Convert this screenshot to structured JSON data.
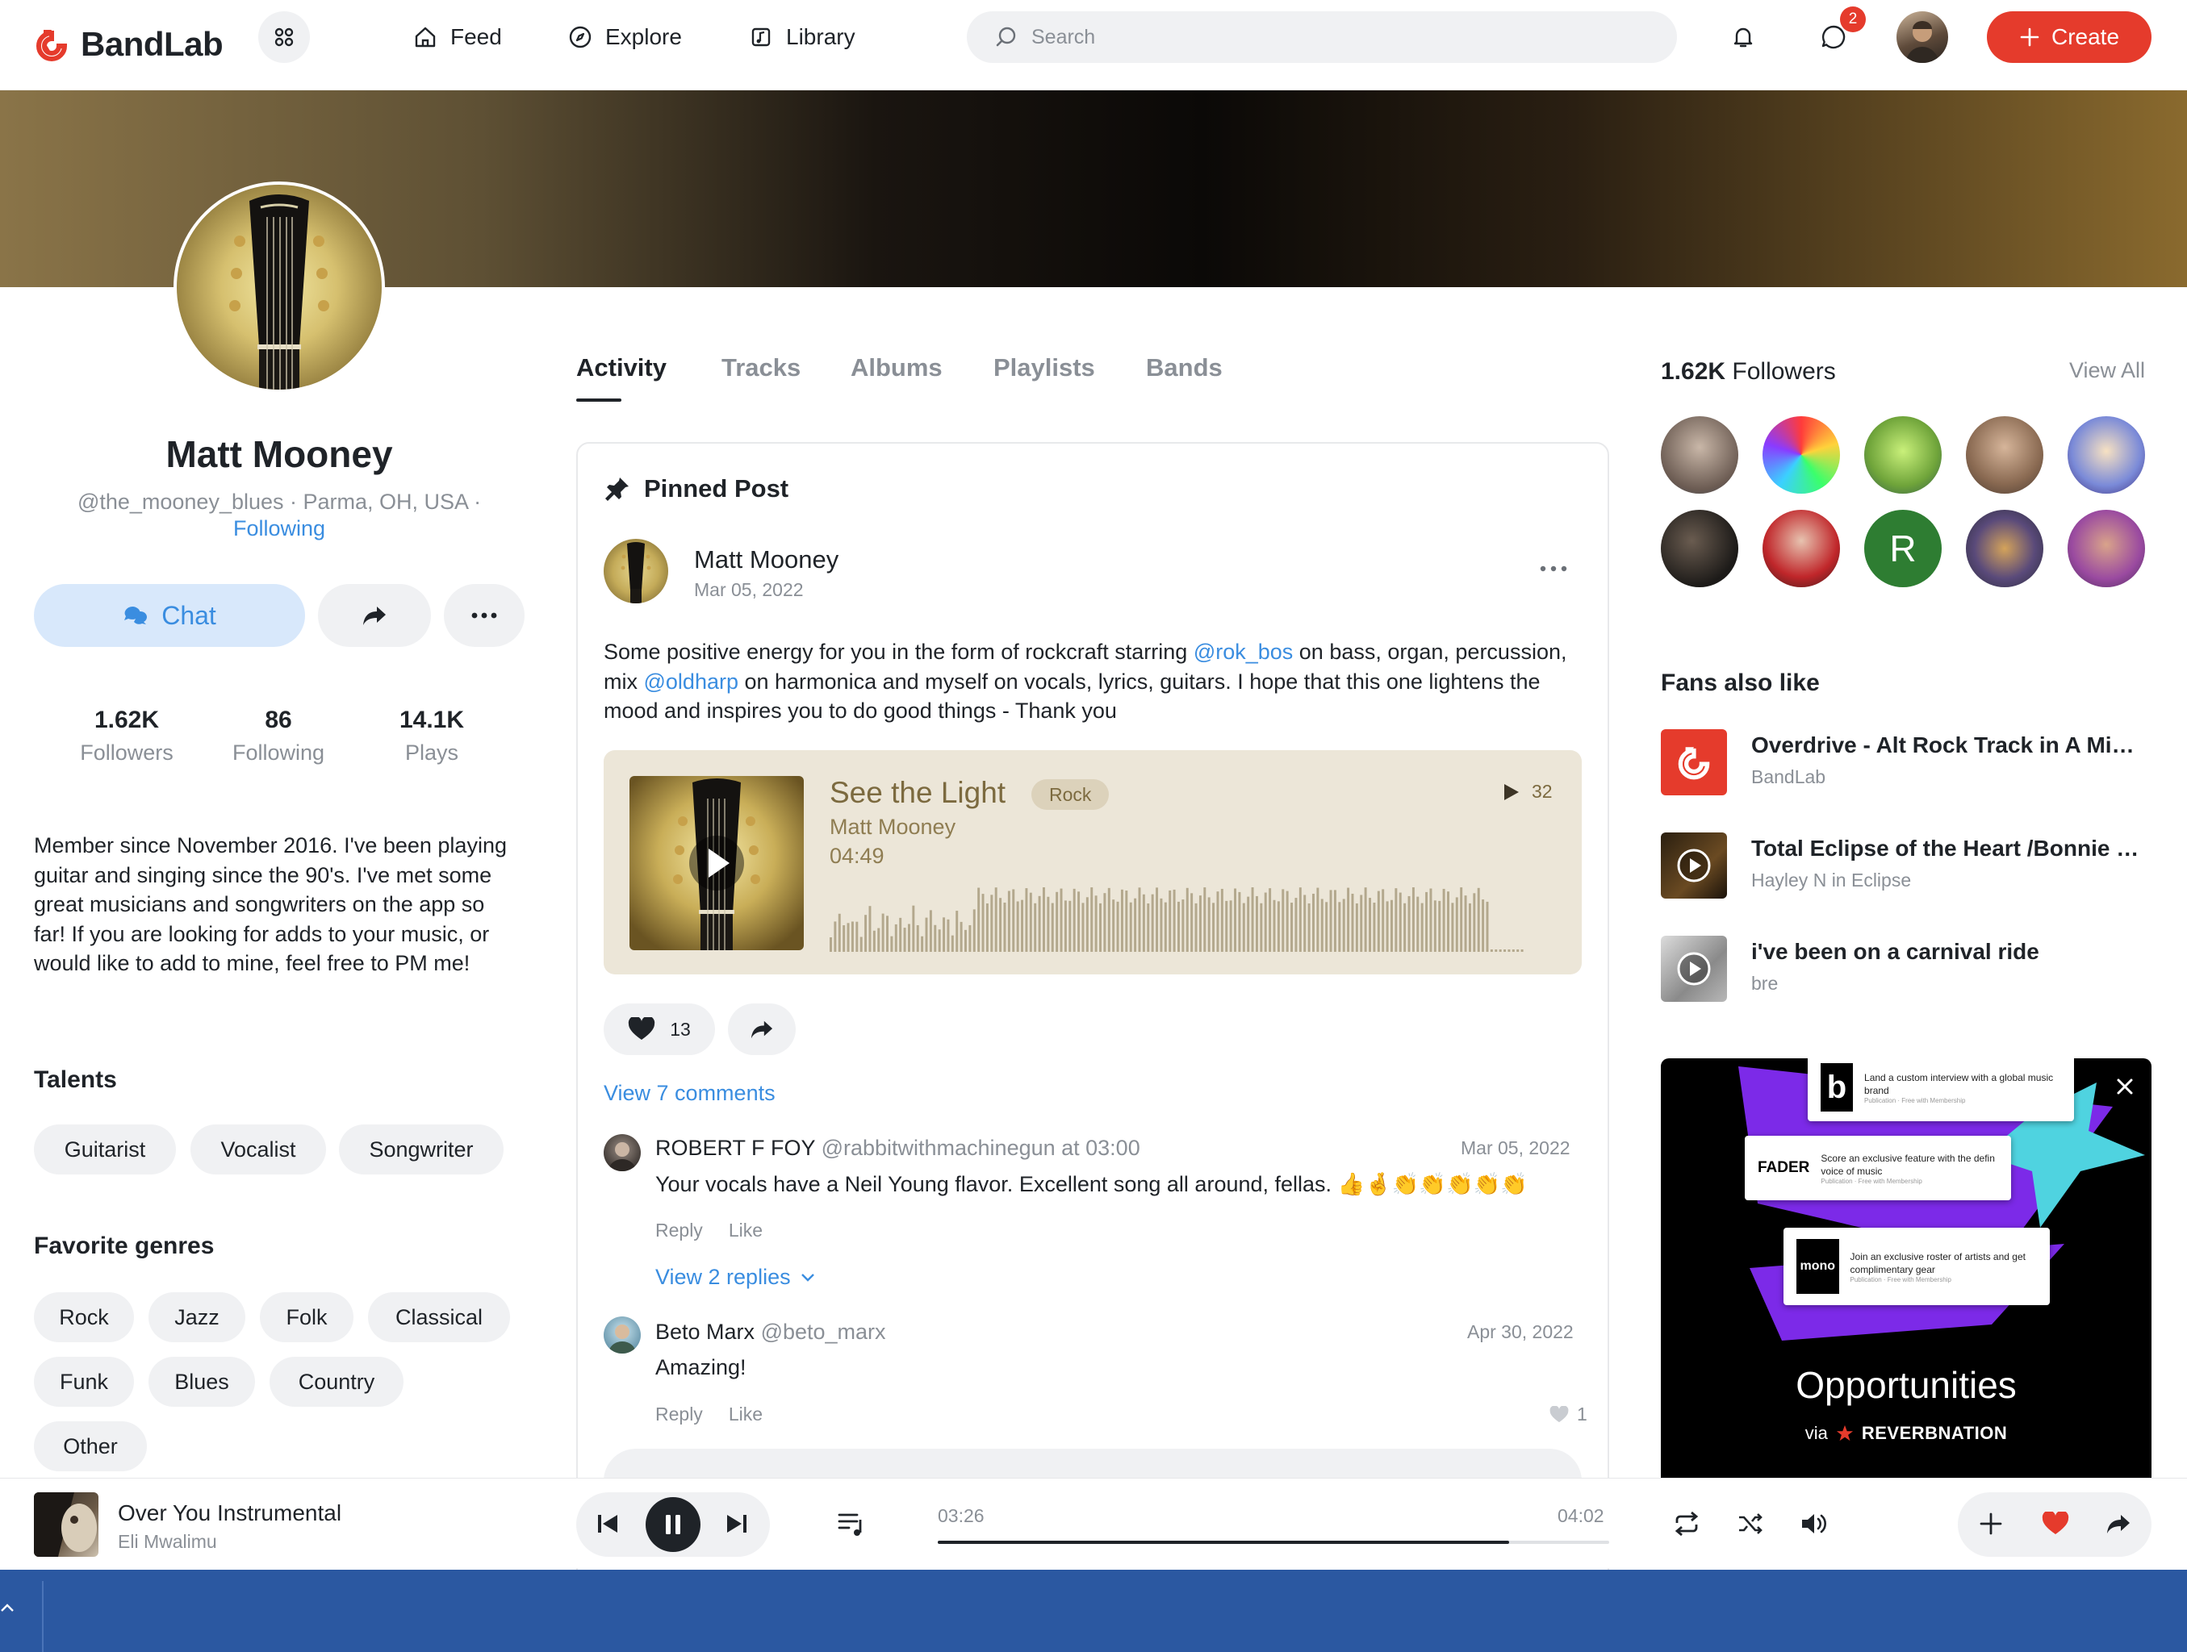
{
  "brand": {
    "name": "BandLab",
    "accent": "#e53b2c",
    "link": "#3a8de0"
  },
  "nav": {
    "items": [
      {
        "label": "Feed",
        "icon": "home-icon"
      },
      {
        "label": "Explore",
        "icon": "compass-icon"
      },
      {
        "label": "Library",
        "icon": "library-icon"
      }
    ],
    "search_placeholder": "Search",
    "messages_badge": "2",
    "create_label": "Create"
  },
  "profile": {
    "name": "Matt Mooney",
    "meta": "@the_mooney_blues · Parma, OH, USA ·",
    "following_status": "Following",
    "chat_label": "Chat",
    "stats": [
      {
        "value": "1.62K",
        "label": "Followers"
      },
      {
        "value": "86",
        "label": "Following"
      },
      {
        "value": "14.1K",
        "label": "Plays"
      }
    ],
    "bio": "Member since November 2016. I've been playing guitar and singing since the 90's. I've met some great musicians and songwriters on the app so far! If you are looking for adds to your music, or would like to add to mine, feel free to PM me!",
    "talents_title": "Talents",
    "talents": [
      "Guitarist",
      "Vocalist",
      "Songwriter"
    ],
    "genres_title": "Favorite genres",
    "genres": [
      "Rock",
      "Jazz",
      "Folk",
      "Classical",
      "Funk",
      "Blues",
      "Country",
      "Other"
    ]
  },
  "tabs": [
    "Activity",
    "Tracks",
    "Albums",
    "Playlists",
    "Bands"
  ],
  "post": {
    "pinned_label": "Pinned Post",
    "author": "Matt Mooney",
    "date": "Mar 05, 2022",
    "text_parts": {
      "p1": "Some positive energy for you in the form of rockcraft starring ",
      "m1": "@rok_bos",
      "p2": " on bass, organ, percussion, mix ",
      "m2": "@oldharp",
      "p3": " on harmonica and myself on vocals, lyrics, guitars. I hope that this one lightens the mood and inspires you to do good things - Thank you"
    },
    "track": {
      "title": "See the Light",
      "genre": "Rock",
      "artist": "Matt Mooney",
      "duration": "04:49",
      "plays": "32"
    },
    "likes": "13",
    "view_comments": "View 7 comments",
    "comments": [
      {
        "author": "ROBERT F FOY",
        "handle": "@rabbitwithmachinegun at 03:00",
        "date": "Mar 05, 2022",
        "text": "Your vocals have a Neil Young flavor. Excellent song all around, fellas. 👍🤞👏👏👏👏👏",
        "reply": "Reply",
        "like": "Like",
        "view_replies": "View 2 replies"
      },
      {
        "author": "Beto Marx",
        "handle": "@beto_marx",
        "date": "Apr 30, 2022",
        "text": "Amazing!",
        "reply": "Reply",
        "like": "Like",
        "likes": "1"
      }
    ]
  },
  "sidebar": {
    "followers_count": "1.62K",
    "followers_label": "Followers",
    "view_all": "View All",
    "fans_title": "Fans also like",
    "fans": [
      {
        "title": "Overdrive - Alt Rock Track in A Mino...",
        "sub": "BandLab"
      },
      {
        "title": "Total Eclipse of the Heart /Bonnie Ty...",
        "sub": "Hayley N in Eclipse"
      },
      {
        "title": "i've been on a carnival ride",
        "sub": "bre"
      }
    ],
    "follower_initial": "R",
    "ad": {
      "title": "Opportunities",
      "via": "via",
      "partner": "REVERBNATION",
      "cards": [
        {
          "brand": "b",
          "text": "Land a custom interview with a global music brand",
          "sub": "Publication · Free with Membership"
        },
        {
          "brand": "FADER",
          "text": "Score an exclusive feature with the defin voice of music",
          "sub": "Publication · Free with Membership"
        },
        {
          "brand": "mono",
          "text": "Join an exclusive roster of artists and get complimentary gear",
          "sub": "Publication · Free with Membership"
        }
      ]
    }
  },
  "player": {
    "title": "Over You Instrumental",
    "artist": "Eli Mwalimu",
    "current_time": "03:26",
    "total_time": "04:02",
    "progress": 0.851
  }
}
